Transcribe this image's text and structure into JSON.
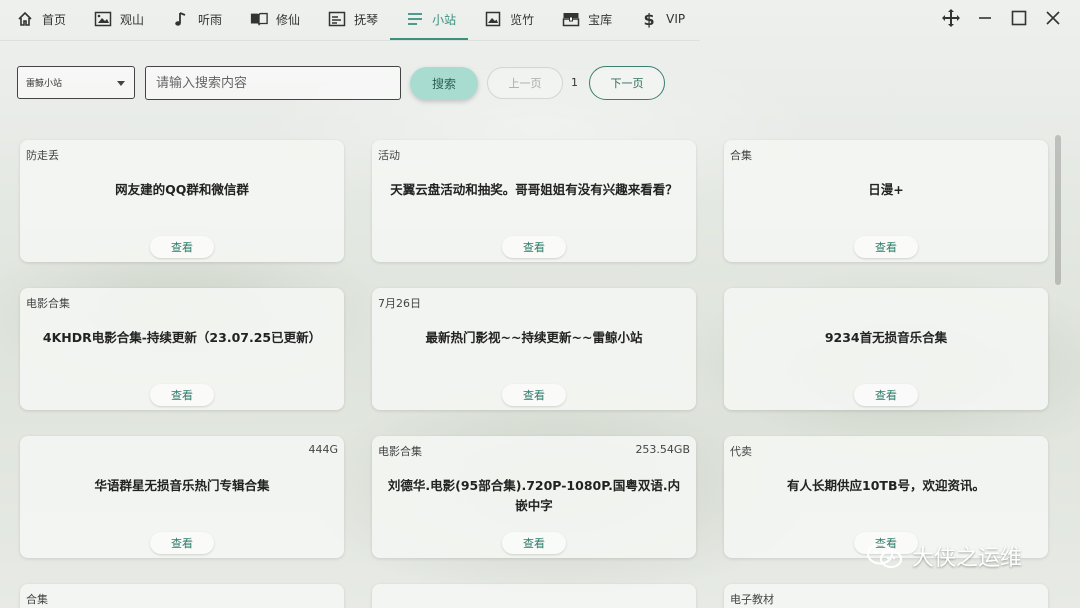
{
  "nav": {
    "items": [
      {
        "label": "首页",
        "icon": "home-icon"
      },
      {
        "label": "观山",
        "icon": "image-frame-icon"
      },
      {
        "label": "听雨",
        "icon": "music-note-icon"
      },
      {
        "label": "修仙",
        "icon": "book-icon"
      },
      {
        "label": "抚琴",
        "icon": "list-box-icon"
      },
      {
        "label": "小站",
        "icon": "menu-lines-icon",
        "active": true
      },
      {
        "label": "览竹",
        "icon": "picture-icon"
      },
      {
        "label": "宝库",
        "icon": "treasure-box-icon"
      },
      {
        "label": "VIP",
        "icon": "dollar-icon"
      }
    ]
  },
  "window_controls": {
    "move": "move-icon",
    "minimize": "minimize-icon",
    "maximize": "maximize-icon",
    "close": "close-icon"
  },
  "toolbar": {
    "source_select": "雷鲸小站",
    "search_placeholder": "请输入搜索内容",
    "search_label": "搜索",
    "prev_label": "上一页",
    "page_number": "1",
    "next_label": "下一页"
  },
  "cards": [
    {
      "tag": "防走丢",
      "size": "",
      "title": "网友建的QQ群和微信群",
      "action": "查看"
    },
    {
      "tag": "活动",
      "size": "",
      "title": "天翼云盘活动和抽奖。哥哥姐姐有没有兴趣来看看？",
      "action": "查看"
    },
    {
      "tag": "合集",
      "size": "",
      "title": "日漫+",
      "action": "查看"
    },
    {
      "tag": "电影合集",
      "size": "",
      "title": "4KHDR电影合集-持续更新（23.07.25已更新）",
      "action": "查看"
    },
    {
      "tag": "7月26日",
      "size": "",
      "title": "最新热门影视~~持续更新~~雷鲸小站",
      "action": "查看"
    },
    {
      "tag": "",
      "size": "",
      "title": "9234首无损音乐合集",
      "action": "查看"
    },
    {
      "tag": "",
      "size": "444G",
      "title": "华语群星无损音乐热门专辑合集",
      "action": "查看"
    },
    {
      "tag": "电影合集",
      "size": "253.54GB",
      "title": "刘德华.电影(95部合集).720P-1080P.国粤双语.内嵌中字",
      "action": "查看"
    },
    {
      "tag": "代卖",
      "size": "",
      "title": "有人长期供应10TB号，欢迎资讯。",
      "action": "查看"
    },
    {
      "tag": "合集",
      "size": "",
      "title": "",
      "action": ""
    },
    {
      "tag": "",
      "size": "",
      "title": "",
      "action": ""
    },
    {
      "tag": "电子教材",
      "size": "",
      "title": "",
      "action": ""
    }
  ],
  "watermark": {
    "text": "大侠之运维"
  },
  "colors": {
    "accent": "#3a8f7d",
    "search_button": "#a9dcd0"
  }
}
